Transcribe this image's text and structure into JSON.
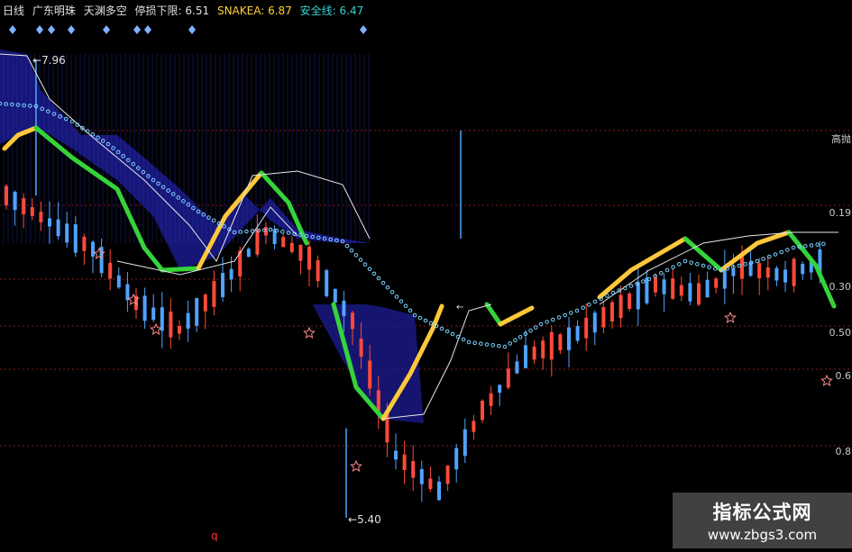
{
  "header": {
    "period": "日线",
    "indicator": "广东明珠",
    "signal": "天渊多空",
    "stop_loss_label": "停损下限:",
    "stop_loss_value": "6.51",
    "snake_label": "SNAKEA:",
    "snake_value": "6.87",
    "safety_label": "安全线:",
    "safety_value": "6.47"
  },
  "right_axis": {
    "ticks": [
      "高抛",
      "0.19",
      "0.30",
      "0.50",
      "0.6",
      "0.8"
    ]
  },
  "annotations": {
    "high": "7.96",
    "low": "5.40",
    "mid_left_arrow": "←",
    "q_mark": "q"
  },
  "watermark": {
    "line1": "指标公式网",
    "line2": "www.zbgs3.com"
  },
  "colors": {
    "background": "#000000",
    "up_candle": "#ff4a3a",
    "down_candle": "#4fa3ff",
    "fill_band": "#1a1a8c",
    "fill_stripes": "#3038c8",
    "green_line": "#35d43a",
    "yellow_line": "#ffc83a",
    "white_line": "#e6e6e6",
    "dotted_line": "#7fd3ff",
    "star": "#ff8a8a",
    "diamond": "#7fb2ff"
  },
  "chart_data": {
    "type": "line",
    "title": "",
    "price_points": [
      {
        "x": 0,
        "y": 7.2
      },
      {
        "x": 5,
        "y": 7.05
      },
      {
        "x": 10,
        "y": 6.9
      },
      {
        "x": 15,
        "y": 6.6
      },
      {
        "x": 20,
        "y": 6.45
      },
      {
        "x": 25,
        "y": 6.7
      },
      {
        "x": 30,
        "y": 7.0
      },
      {
        "x": 35,
        "y": 6.85
      },
      {
        "x": 40,
        "y": 6.5
      },
      {
        "x": 45,
        "y": 5.75
      },
      {
        "x": 50,
        "y": 5.55
      },
      {
        "x": 55,
        "y": 6.0
      },
      {
        "x": 60,
        "y": 6.3
      },
      {
        "x": 65,
        "y": 6.4
      },
      {
        "x": 70,
        "y": 6.55
      },
      {
        "x": 75,
        "y": 6.7
      },
      {
        "x": 80,
        "y": 6.65
      },
      {
        "x": 85,
        "y": 6.8
      },
      {
        "x": 90,
        "y": 6.75
      },
      {
        "x": 95,
        "y": 6.85
      }
    ],
    "marks": {
      "high": 7.96,
      "low": 5.4
    },
    "ylim": [
      5.2,
      8.1
    ]
  }
}
